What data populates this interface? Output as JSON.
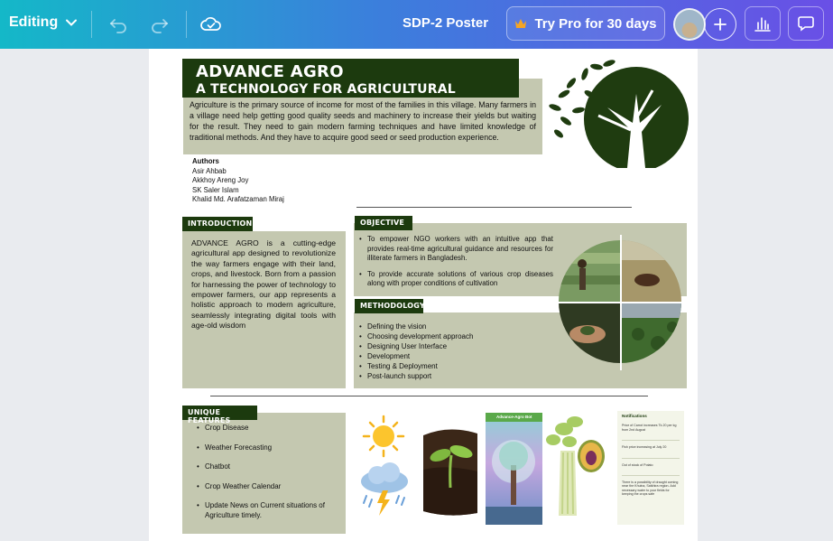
{
  "toolbar": {
    "editing_label": "Editing",
    "doc_title": "SDP-2 Poster",
    "pro_label": "Try Pro for 30 days",
    "colors": {
      "gradient_start": "#14b8c8",
      "gradient_end": "#6a4fe6"
    },
    "icons": [
      "chevron-down-icon",
      "undo-icon",
      "redo-icon",
      "cloud-saved-icon",
      "crown-icon",
      "avatar",
      "plus-icon",
      "insights-icon",
      "comment-icon"
    ]
  },
  "poster": {
    "title_line1": "ADVANCE AGRO",
    "title_line2": "A TECHNOLOGY FOR AGRICULTURAL ADVANCEMENT",
    "intro": "Agriculture is the primary source of income for most of the families in this village. Many farmers in a village need help getting good quality seeds and machinery to increase their yields but waiting for the result. They need to gain modern farming techniques and have limited knowledge of traditional methods. And they have to acquire good seed or seed production experience.",
    "authors_heading": "Authors",
    "authors": [
      "Asir Ahbab",
      "Akkhoy Areng Joy",
      "SK Saler Islam",
      "Khalid Md. Arafatzaman Miraj"
    ],
    "introduction": {
      "label": "INTRODUCTION",
      "text": "ADVANCE AGRO is a cutting-edge agricultural app designed to revolutionize the way farmers engage with their land, crops, and livestock. Born from a passion for harnessing the power of technology to empower farmers, our app represents a holistic approach to modern agriculture, seamlessly integrating digital tools with age-old wisdom"
    },
    "objective": {
      "label": "OBJECTIVE",
      "items": [
        "To empower NGO workers with an intuitive app that provides real-time agricultural guidance and resources for illiterate farmers in Bangladesh.",
        "To provide accurate solutions of various crop diseases along with proper conditions of cultivation"
      ]
    },
    "methodology": {
      "label": "METHODOLOGY",
      "items": [
        "Defining the vision",
        "Choosing development approach",
        "Designing User Interface",
        "Development",
        "Testing & Deployment",
        "Post-launch support"
      ]
    },
    "features": {
      "label": "UNIQUE FEATURES",
      "items": [
        "Crop Disease",
        "Weather Forecasting",
        "Chatbot",
        "Crop Weather Calendar",
        "Update News on Current situations of Agriculture timely."
      ]
    },
    "chatbot_screen_title": "Advance-Agro Bot",
    "notifications_screen": {
      "title": "Notifications",
      "items": [
        "Price of Carrot increases Tk.20 per kg from 2nd August",
        "Fish price increasing at July 20",
        "Out of stock of Potato",
        "There is a possibility of draught coming near the Khulna, Satkhira region. Add necessary water to your fields for keeping the crops safe"
      ]
    },
    "colors": {
      "accent_dark": "#1c3a0e",
      "olive_box": "#c4c8b0"
    }
  }
}
